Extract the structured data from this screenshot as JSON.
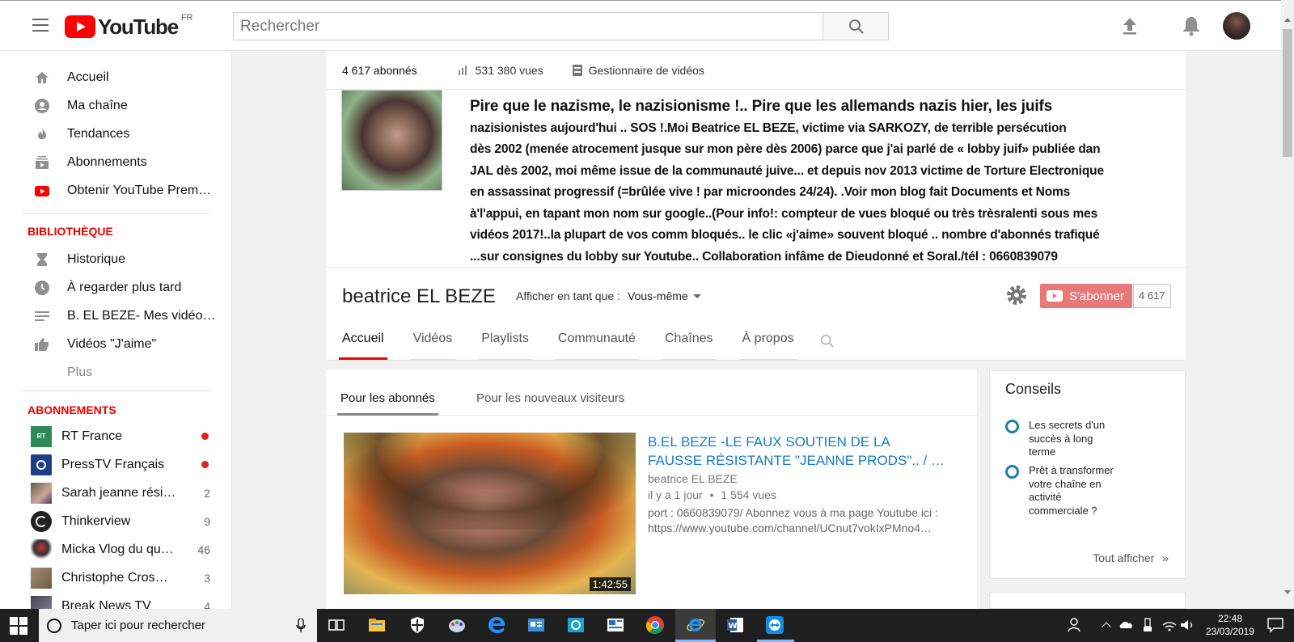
{
  "header": {
    "logo_text": "YouTube",
    "country": "FR",
    "search_placeholder": "Rechercher"
  },
  "sidebar": {
    "nav": [
      {
        "label": "Accueil",
        "icon": "home-icon"
      },
      {
        "label": "Ma chaîne",
        "icon": "account-icon"
      },
      {
        "label": "Tendances",
        "icon": "flame-icon"
      },
      {
        "label": "Abonnements",
        "icon": "subscriptions-icon"
      },
      {
        "label": "Obtenir YouTube Prem…",
        "icon": "youtube-icon"
      }
    ],
    "library_title": "BIBLIOTHÈQUE",
    "library": [
      {
        "label": "Historique",
        "icon": "hourglass-icon"
      },
      {
        "label": "À regarder plus tard",
        "icon": "clock-icon"
      },
      {
        "label": "B. EL BEZE- Mes vidéo…",
        "icon": "playlist-icon"
      },
      {
        "label": "Vidéos \"J'aime\"",
        "icon": "thumb-up-icon"
      },
      {
        "label": "Plus",
        "icon": ""
      }
    ],
    "subs_title": "ABONNEMENTS",
    "subs": [
      {
        "label": "RT France",
        "badge": "",
        "live": true
      },
      {
        "label": "PressTV Français",
        "badge": "",
        "live": true
      },
      {
        "label": "Sarah jeanne rési…",
        "badge": "2",
        "live": false
      },
      {
        "label": "Thinkerview",
        "badge": "9",
        "live": false
      },
      {
        "label": "Micka Vlog du qu…",
        "badge": "46",
        "live": false
      },
      {
        "label": "Christophe Cros…",
        "badge": "3",
        "live": false
      },
      {
        "label": "Break News TV",
        "badge": "4",
        "live": false
      }
    ]
  },
  "stats": {
    "subscribers": "4 617 abonnés",
    "views": "531 380 vues",
    "manager": "Gestionnaire de vidéos"
  },
  "banner": {
    "lines": [
      "Pire que le nazisme,  le nazisionisme !.. Pire que les allemands nazis hier, les juifs",
      "nazisionistes aujourd'hui .. SOS !.Moi Beatrice EL  BEZE, victime via SARKOZY, de terrible persécution",
      "dès 2002 (menée atrocement jusque sur mon père dès 2006) parce que j'ai parlé de « lobby juif» publiée dan",
      "JAL dès 2002, moi même issue de la communauté juive... et depuis nov 2013 victime de Torture Electronique",
      "en assassinat progressif (=brûlée vive ! par microondes 24/24). .Voir mon blog fait Documents et Noms",
      "à'l'appui, en tapant mon nom sur google..(Pour info!: compteur de vues bloqué ou très trèsralenti sous mes",
      "vidéos 2017!..la plupart de vos comm bloqués.. le clic «j'aime» souvent bloqué .. nombre d'abonnés trafiqué",
      "...sur consignes du lobby sur Youtube.. Collaboration infâme de Dieudonné et Soral./tél : 0660839079"
    ]
  },
  "channel": {
    "name": "beatrice EL BEZE",
    "view_as_label": "Afficher en tant que :",
    "view_as_value": "Vous-même",
    "subscribe_label": "S'abonner",
    "subscribe_count": "4 617",
    "tabs": [
      "Accueil",
      "Vidéos",
      "Playlists",
      "Communauté",
      "Chaînes",
      "À propos"
    ]
  },
  "feed": {
    "tabs": [
      "Pour les abonnés",
      "Pour les nouveaux visiteurs"
    ],
    "video": {
      "title": "B.EL BEZE -LE FAUX SOUTIEN DE LA FAUSSE RÉSISTANTE \"JEANNE PRODS\".. / …",
      "author": "beatrice EL BEZE",
      "age": "il y a 1 jour",
      "views": "1 554 vues",
      "desc1": "port : 0660839079/ Abonnez vous à ma page Youtube ici :",
      "desc2": "https://www.youtube.com/channel/UCnut7vokIxPMno4…",
      "duration": "1:42:55"
    }
  },
  "tips": {
    "title": "Conseils",
    "items": [
      "Les secrets d'un succès à long terme",
      "Prêt à transformer votre chaîne en activité commerciale ?"
    ],
    "show_all": "Tout afficher",
    "show_all_arrow": "»"
  },
  "taskbar": {
    "search_placeholder": "Taper ici pour rechercher",
    "time": "22:48",
    "date": "23/03/2019"
  },
  "colors": {
    "accent_red": "#ff0000",
    "link_blue": "#167ac6",
    "subscribe_btn": "#e8787a"
  }
}
